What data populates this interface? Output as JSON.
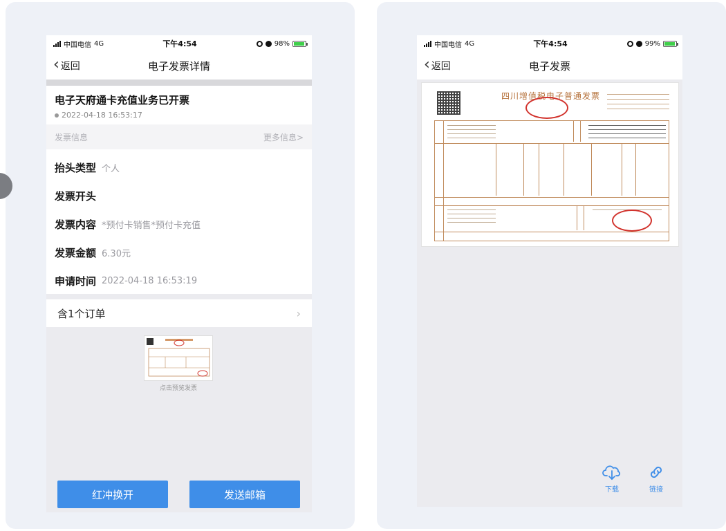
{
  "left_phone": {
    "status": {
      "carrier": "中国电信",
      "network": "4G",
      "time": "下午4:54",
      "battery": "98%"
    },
    "nav": {
      "back_label": "返回",
      "title": "电子发票详情"
    },
    "header": {
      "title": "电子天府通卡充值业务已开票",
      "time": "2022-04-18 16:53:17"
    },
    "section": {
      "title": "发票信息",
      "more": "更多信息>"
    },
    "info_rows": [
      {
        "label": "抬头类型",
        "value": "个人"
      },
      {
        "label": "发票开头",
        "value": ""
      },
      {
        "label": "发票内容",
        "value": "*预付卡销售*预付卡充值"
      },
      {
        "label": "发票金额",
        "value": "6.30元"
      },
      {
        "label": "申请时间",
        "value": "2022-04-18 16:53:19"
      }
    ],
    "order": {
      "label": "含1个订单"
    },
    "preview": {
      "caption": "点击预览发票"
    },
    "buttons": {
      "red_label": "红冲换开",
      "send_label": "发送邮箱"
    }
  },
  "right_phone": {
    "status": {
      "carrier": "中国电信",
      "network": "4G",
      "time": "下午4:54",
      "battery": "99%"
    },
    "nav": {
      "back_label": "返回",
      "title": "电子发票"
    },
    "invoice": {
      "title": "四川增值税电子普通发票"
    },
    "actions": {
      "download_label": "下载",
      "link_label": "链接"
    }
  },
  "colors": {
    "accent": "#3f8ee8",
    "stamp": "#d2342e",
    "invoice_line": "#c08b5c"
  },
  "icons": [
    "signal-icon",
    "battery-icon",
    "chevron-left-icon",
    "chevron-right-icon",
    "cloud-download-icon",
    "link-icon",
    "qr-code-icon"
  ]
}
